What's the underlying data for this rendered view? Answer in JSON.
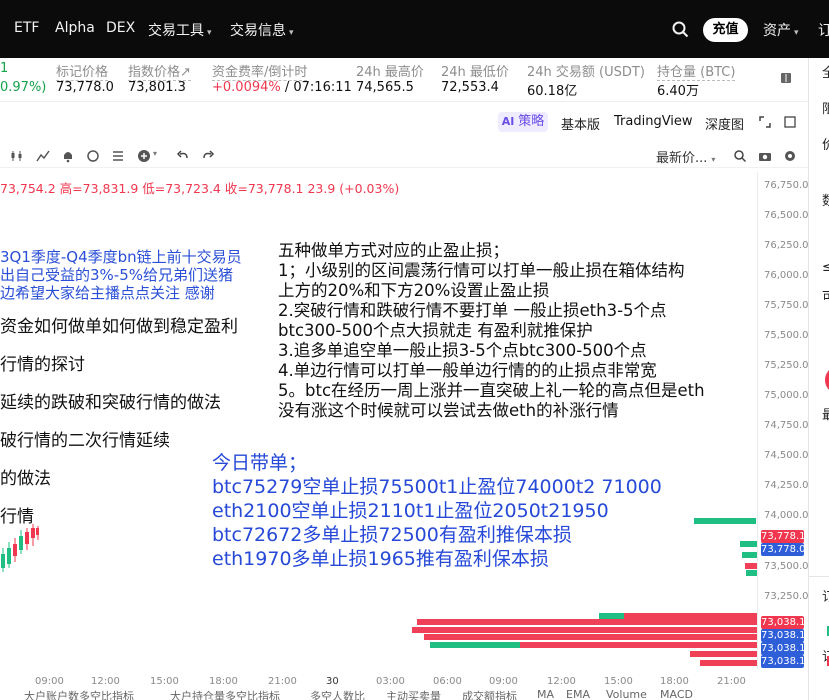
{
  "nav": {
    "items": [
      "ETF",
      "Alpha",
      "DEX",
      "交易工具",
      "交易信息"
    ],
    "deposit": "充值",
    "assets": "资产",
    "order_cut": "订"
  },
  "ticker": {
    "left_value": "1",
    "left_change": "0.97%)",
    "mark_price_label": "标记价格",
    "mark_price": "73,778.0",
    "index_price_label": "指数价格↗",
    "index_price": "73,801.3",
    "funding_label": "资金费率/倒计时",
    "funding_rate": "+0.0094%",
    "countdown": "/ 07:16:11",
    "high_label": "24h 最高价",
    "high": "74,565.5",
    "low_label": "24h 最低价",
    "low": "72,553.4",
    "volume_label": "24h 交易额 (USDT)",
    "volume": "60.18亿",
    "oi_label": "持仓量 (BTC)",
    "oi": "6.40万"
  },
  "toolbar": {
    "strategy": "策略",
    "basic": "基本版",
    "tradingview": "TradingView",
    "depth": "深度图",
    "latest_price": "最新价..."
  },
  "ohlc": {
    "text": "73,754.2 高=73,831.9 低=73,723.4 收=73,778.1 23.9 (+0.03%)"
  },
  "price_axis": [
    "76,750.0",
    "76,500.0",
    "76,250.0",
    "76,000.0",
    "75,750.0",
    "75,500.0",
    "75,250.0",
    "75,000.0",
    "74,750.0",
    "74,500.0",
    "74,250.0",
    "74,000.0",
    "73,500.0",
    "73,250.0"
  ],
  "price_tags": {
    "last_red": "73,778.1",
    "mark_blue": "73,778.0",
    "t1": "73,038.1",
    "t2": "73,038.1",
    "t3": "73,038.1",
    "t4": "73,038.1"
  },
  "time_axis": [
    "09:00",
    "12:00",
    "15:00",
    "18:00",
    "21:00",
    "30",
    "03:00",
    "06:00",
    "09:00",
    "12:00",
    "15:00",
    "18:00",
    "21:00"
  ],
  "bottom_tabs": [
    "大户账户数多空比指标",
    "大户持仓量多空比指标",
    "多空人数比",
    "主动买卖量",
    "成交额指标",
    "MA",
    "EMA",
    "Volume",
    "MACD"
  ],
  "overlay_left": {
    "line1": "3Q1季度-Q4季度bn链上前十交易员",
    "line2": "出自己受益的3%-5%给兄弟们送猪",
    "line3": "边希望大家给主播点点关注 感谢",
    "line4": "资金如何做单如何做到稳定盈利",
    "line5": "行情的探讨",
    "line6": "延续的跌破和突破行情的做法",
    "line7": "破行情的二次行情延续",
    "line8": "的做法",
    "line9": "行情"
  },
  "notes": [
    "五种做单方式对应的止盈止损；",
    "1；小级别的区间震荡行情可以打单一般止损在箱体结构",
    "上方的20%和下方20%设置止盈止损",
    "2.突破行情和跌破行情不要打单 一般止损eth3-5个点",
    "btc300-500个点大损就走 有盈利就推保护",
    "3.追多单追空单一般止损3-5个点btc300-500个点",
    "4.单边行情可以打单一般单边行情的的止损点非常宽",
    "5。btc在经历一周上涨并一直突破上礼一轮的高点但是eth",
    "没有涨这个时候就可以尝试去做eth的补涨行情"
  ],
  "today": [
    "今日带单；",
    "btc75279空单止损75500t1止盈位74000t2 71000",
    "eth2100空单止损2110t1止盈位2050t21950",
    "btc72672多单止损72500有盈利推保本损",
    "eth1970多单止损1965推有盈利保本损"
  ],
  "right_panel_chars": [
    "全",
    "限",
    "价",
    "数",
    "≤",
    "可",
    "最",
    "订",
    "订"
  ],
  "colors": {
    "up_green": "#16a34a",
    "down_red": "#f0374f",
    "accent_purple": "#6b4ee6",
    "overlay_blue": "#2649d8",
    "mark_blue": "#2f5fd8"
  }
}
